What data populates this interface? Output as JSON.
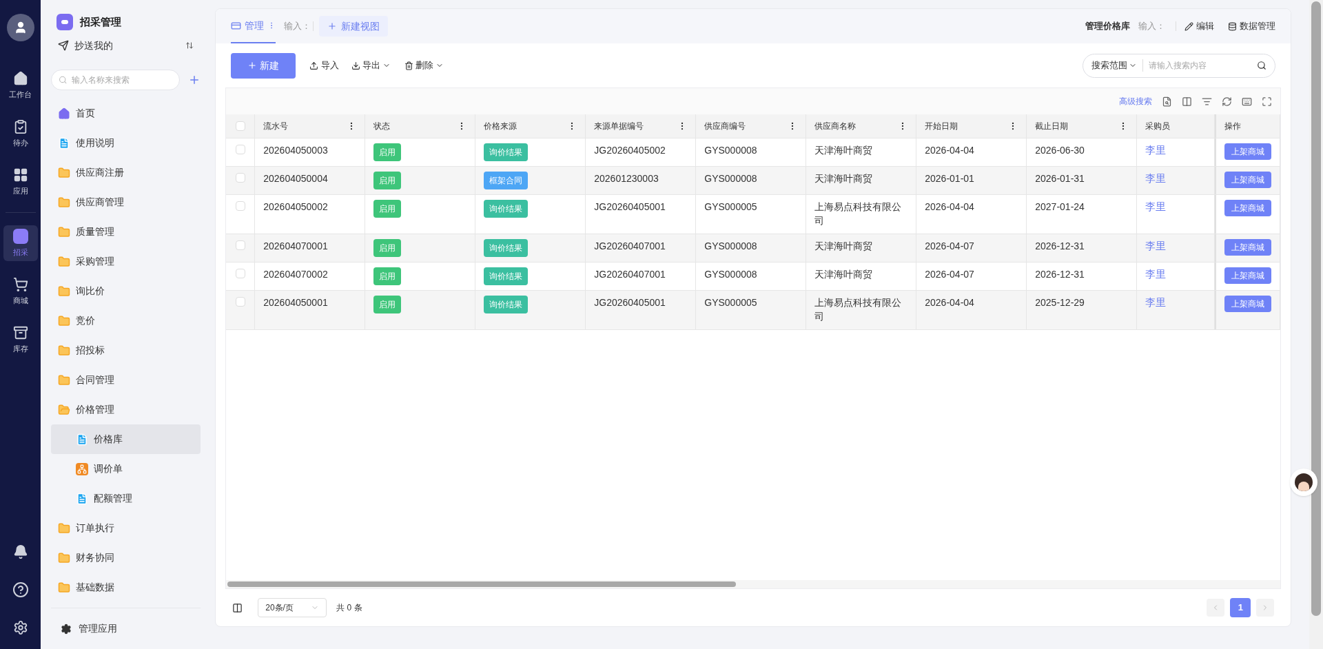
{
  "rail": {
    "items": [
      {
        "label": "工作台",
        "kind": "home",
        "selected": false
      },
      {
        "label": "待办",
        "kind": "todo",
        "selected": false
      },
      {
        "label": "应用",
        "kind": "apps",
        "selected": false
      },
      {
        "label": "招采",
        "kind": "srm",
        "selected": true
      },
      {
        "label": "商城",
        "kind": "cart",
        "selected": false
      },
      {
        "label": "库存",
        "kind": "stock",
        "selected": false
      }
    ]
  },
  "sidebar": {
    "title": "招采管理",
    "cut_item": "抄送我的",
    "search": {
      "placeholder": "输入名称来搜索"
    },
    "items": [
      {
        "label": "首页",
        "kind": "home",
        "selected": false
      },
      {
        "label": "使用说明",
        "kind": "doc",
        "selected": false
      },
      {
        "label": "供应商注册",
        "kind": "folder",
        "selected": false
      },
      {
        "label": "供应商管理",
        "kind": "folder",
        "selected": false
      },
      {
        "label": "质量管理",
        "kind": "folder",
        "selected": false
      },
      {
        "label": "采购管理",
        "kind": "folder",
        "selected": false
      },
      {
        "label": "询比价",
        "kind": "folder",
        "selected": false
      },
      {
        "label": "竞价",
        "kind": "folder",
        "selected": false
      },
      {
        "label": "招投标",
        "kind": "folder",
        "selected": false
      },
      {
        "label": "合同管理",
        "kind": "folder",
        "selected": false
      },
      {
        "label": "价格管理",
        "kind": "folder",
        "selected": false,
        "expanded": true,
        "children": [
          {
            "label": "价格库",
            "kind": "doc",
            "selected": true
          },
          {
            "label": "调价单",
            "kind": "chart",
            "selected": false
          },
          {
            "label": "配额管理",
            "kind": "doc",
            "selected": false
          }
        ]
      },
      {
        "label": "订单执行",
        "kind": "folder",
        "selected": false
      },
      {
        "label": "财务协同",
        "kind": "folder",
        "selected": false
      },
      {
        "label": "基础数据",
        "kind": "folder",
        "selected": false
      }
    ],
    "footer": "管理应用"
  },
  "views": {
    "tabs": [
      {
        "label": "管理",
        "selected": true
      }
    ],
    "input_placeholder": "输入：",
    "new_view": "新建视图"
  },
  "header_right": {
    "title": "管理价格库",
    "input_placeholder": "输入：",
    "edit": "编辑",
    "data": "数据管理"
  },
  "toolbar": {
    "new": "新建",
    "import": "导入",
    "export": "导出",
    "delete": "删除",
    "scope": "搜索范围",
    "search_placeholder": "请输入搜索内容"
  },
  "table": {
    "advanced_search": "高级搜索",
    "all_checked": false,
    "columns": [
      "流水号",
      "状态",
      "价格来源",
      "来源单据编号",
      "供应商编号",
      "供应商名称",
      "开始日期",
      "截止日期",
      "采购员",
      "操作"
    ],
    "rows": [
      {
        "serial": "202604050003",
        "status": "启用",
        "source": "询价结果",
        "color": "#3bbfa0",
        "doc": "JG20260405002",
        "supplier_no": "GYS000008",
        "supplier": "天津海叶商贸",
        "start": "2026-04-04",
        "end": "2026-06-30",
        "buyer": "李里",
        "action": "上架商城",
        "checked": false
      },
      {
        "serial": "202604050004",
        "status": "启用",
        "source": "框架合同",
        "color": "#4da6f5",
        "doc": "202601230003",
        "supplier_no": "GYS000008",
        "supplier": "天津海叶商贸",
        "start": "2026-01-01",
        "end": "2026-01-31",
        "buyer": "李里",
        "action": "上架商城",
        "checked": false
      },
      {
        "serial": "202604050002",
        "status": "启用",
        "source": "询价结果",
        "color": "#3bbfa0",
        "doc": "JG20260405001",
        "supplier_no": "GYS000005",
        "supplier": "上海易点科技有限公司",
        "start": "2026-04-04",
        "end": "2027-01-24",
        "buyer": "李里",
        "action": "上架商城",
        "checked": false
      },
      {
        "serial": "202604070001",
        "status": "启用",
        "source": "询价结果",
        "color": "#3bbfa0",
        "doc": "JG20260407001",
        "supplier_no": "GYS000008",
        "supplier": "天津海叶商贸",
        "start": "2026-04-07",
        "end": "2026-12-31",
        "buyer": "李里",
        "action": "上架商城",
        "checked": false
      },
      {
        "serial": "202604070002",
        "status": "启用",
        "source": "询价结果",
        "color": "#3bbfa0",
        "doc": "JG20260407001",
        "supplier_no": "GYS000008",
        "supplier": "天津海叶商贸",
        "start": "2026-04-07",
        "end": "2026-12-31",
        "buyer": "李里",
        "action": "上架商城",
        "checked": false
      },
      {
        "serial": "202604050001",
        "status": "启用",
        "source": "询价结果",
        "color": "#3bbfa0",
        "doc": "JG20260405001",
        "supplier_no": "GYS000005",
        "supplier": "上海易点科技有限公司",
        "start": "2026-04-04",
        "end": "2025-12-29",
        "buyer": "李里",
        "action": "上架商城",
        "checked": false
      }
    ]
  },
  "pagination": {
    "page_size": "20条/页",
    "total": "共 0 条",
    "pages": [
      {
        "label": "1",
        "selected": true
      }
    ]
  }
}
